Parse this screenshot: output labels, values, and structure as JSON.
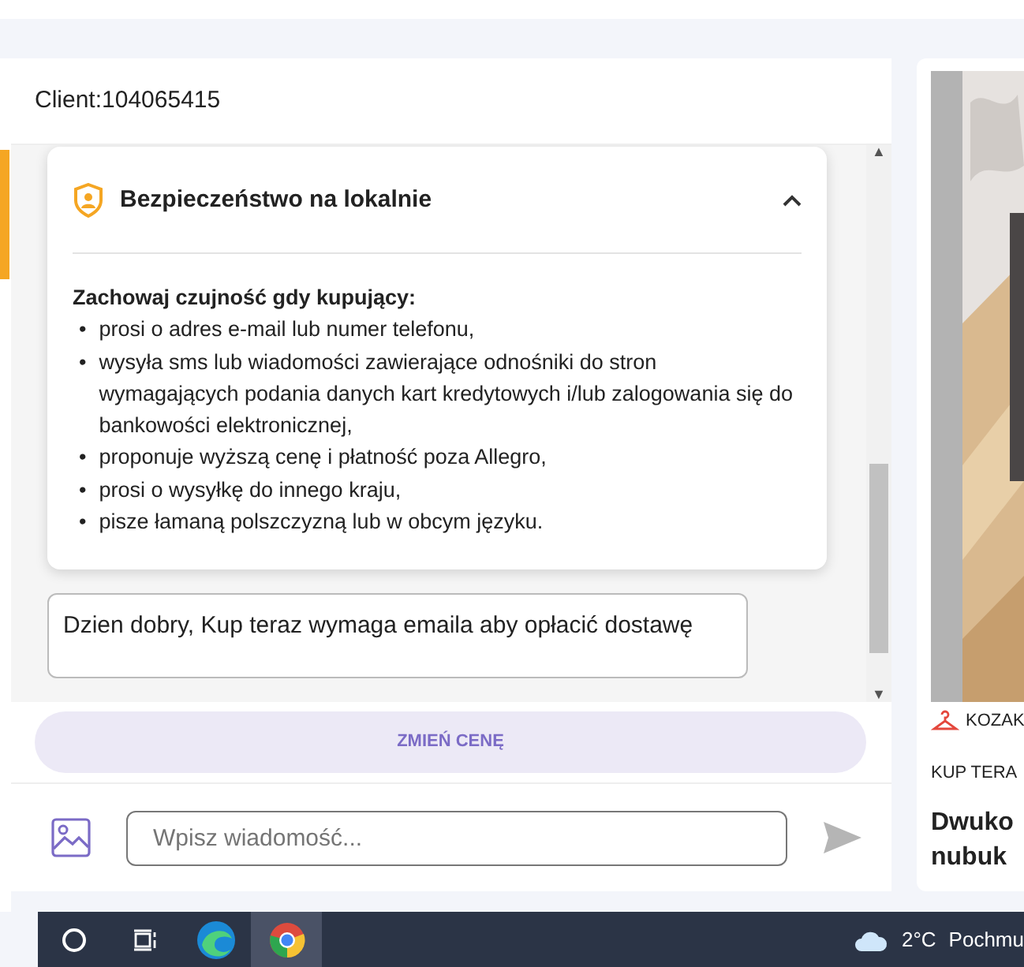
{
  "chat": {
    "client": "Client:104065415",
    "safety_card": {
      "title": "Bezpieczeństwo na lokalnie",
      "expanded": true,
      "lead": "Zachowaj czujność gdy kupujący:",
      "items": [
        {
          "bullet": "•",
          "text": "prosi o adres e-mail lub numer telefonu,"
        },
        {
          "bullet": "•",
          "text": "wysyła sms lub wiadomości zawierające odnośniki do stron wymagających podania danych kart kredytowych i/lub zalogowania się do bankowości elektronicznej,"
        },
        {
          "bullet": "•",
          "text": "proponuje wyższą cenę i płatność poza Allegro,"
        },
        {
          "bullet": "•",
          "text": "prosi o wysyłkę do innego kraju,"
        },
        {
          "bullet": "•",
          "text": "pisze łamaną polszczyzną lub w obcym języku."
        }
      ]
    },
    "scroll": {
      "up": "▲",
      "down": "▼"
    },
    "message": "Dzien dobry, Kup teraz wymaga emaila aby opłacić dostawę",
    "action_button": "ZMIEŃ CENĘ",
    "composer": {
      "placeholder": "Wpisz wiadomość..."
    }
  },
  "offer": {
    "category": "KOZAK",
    "offer_type": "KUP TERA",
    "title": "Dwuko nubuk"
  },
  "taskbar": {
    "weather": "2°C",
    "weather_text": "Pochmu"
  }
}
